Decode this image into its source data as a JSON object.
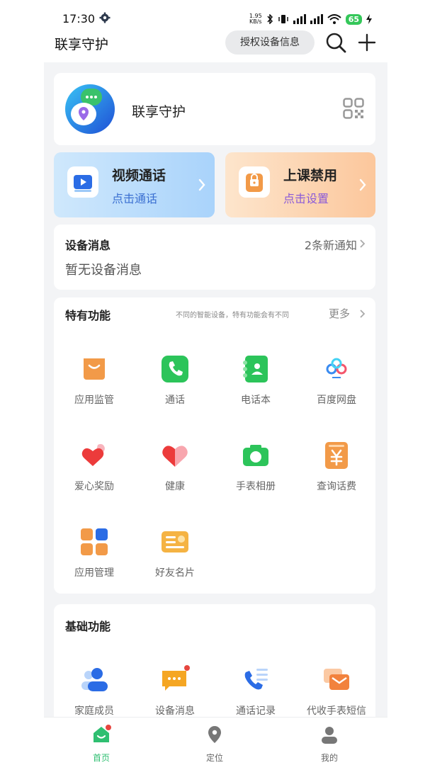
{
  "status_bar": {
    "time": "17:30",
    "net_speed_value": "1.95",
    "net_speed_unit": "KB/s",
    "battery": "65"
  },
  "header": {
    "title": "联享守护",
    "auth_button": "授权设备信息",
    "search_icon": "search-icon",
    "add_icon": "plus-icon"
  },
  "app_card": {
    "name": "联享守护",
    "qr_icon": "qr-code-icon"
  },
  "tiles": {
    "video_call": {
      "title": "视频通话",
      "subtitle": "点击通话"
    },
    "class_ban": {
      "title": "上课禁用",
      "subtitle": "点击设置"
    }
  },
  "device_messages": {
    "title": "设备消息",
    "count": "2条新通知",
    "empty": "暂无设备消息"
  },
  "special_features": {
    "title": "特有功能",
    "description": "不同的智能设备，特有功能会有不同",
    "more": "更多",
    "items": [
      {
        "label": "应用监管",
        "icon": "shopping-bag-icon"
      },
      {
        "label": "通话",
        "icon": "phone-icon"
      },
      {
        "label": "电话本",
        "icon": "contacts-icon"
      },
      {
        "label": "百度网盘",
        "icon": "cloud-icon"
      },
      {
        "label": "爱心奖励",
        "icon": "hearts-icon"
      },
      {
        "label": "健康",
        "icon": "heart-icon"
      },
      {
        "label": "手表相册",
        "icon": "camera-icon"
      },
      {
        "label": "查询话费",
        "icon": "bill-icon"
      },
      {
        "label": "应用管理",
        "icon": "apps-grid-icon"
      },
      {
        "label": "好友名片",
        "icon": "card-icon"
      }
    ]
  },
  "basic_features": {
    "title": "基础功能",
    "items": [
      {
        "label": "家庭成员",
        "icon": "family-icon"
      },
      {
        "label": "设备消息",
        "icon": "message-icon"
      },
      {
        "label": "通话记录",
        "icon": "call-log-icon"
      },
      {
        "label": "代收手表短信",
        "icon": "sms-icon"
      }
    ]
  },
  "bottom_nav": [
    {
      "label": "首页",
      "icon": "home-icon",
      "active": true
    },
    {
      "label": "定位",
      "icon": "location-pin-icon",
      "active": false
    },
    {
      "label": "我的",
      "icon": "profile-icon",
      "active": false
    }
  ],
  "colors": {
    "accent_green": "#2fbf71",
    "orange": "#f29a48",
    "blue": "#2b6ce5",
    "red": "#e6463f"
  }
}
